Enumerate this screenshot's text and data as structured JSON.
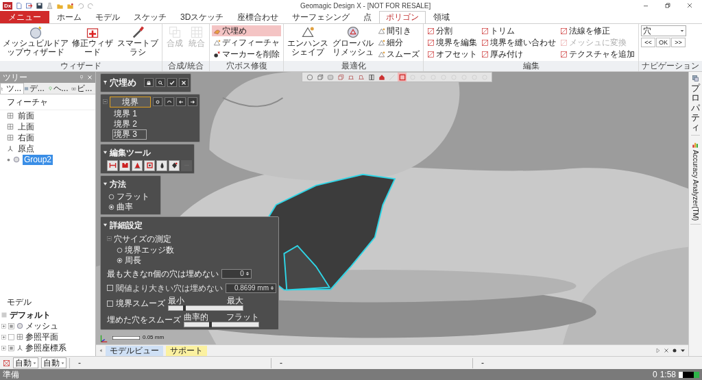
{
  "window": {
    "title": "Geomagic Design X - [NOT FOR RESALE]",
    "app_logo": "Dx"
  },
  "menu_button": "メニュー",
  "tabs": [
    {
      "label": "ホーム",
      "selected": false
    },
    {
      "label": "モデル",
      "selected": false
    },
    {
      "label": "スケッチ",
      "selected": false
    },
    {
      "label": "3Dスケッチ",
      "selected": false
    },
    {
      "label": "座標合わせ",
      "selected": false
    },
    {
      "label": "サーフェシング",
      "selected": false
    },
    {
      "label": "点",
      "selected": false
    },
    {
      "label": "ポリゴン",
      "selected": true
    },
    {
      "label": "領域",
      "selected": false
    }
  ],
  "ribbon": [
    {
      "title": "ウィザード",
      "parts": [
        {
          "kind": "large",
          "label": "メッシュビルドアップウィザード",
          "disabled": false
        },
        {
          "kind": "large",
          "label": "修正ウィザード",
          "disabled": false
        },
        {
          "kind": "large",
          "label": "スマートブラシ",
          "disabled": false
        }
      ]
    },
    {
      "title": "合成/統合",
      "parts": [
        {
          "kind": "large",
          "label": "合成",
          "disabled": true
        },
        {
          "kind": "large",
          "label": "統合",
          "disabled": true
        }
      ]
    },
    {
      "title": "穴ボス修復",
      "parts": [
        {
          "kind": "stack",
          "items": [
            {
              "label": "穴埋め",
              "selected": true,
              "disabled": false
            },
            {
              "label": "ディフィーチャ",
              "selected": false,
              "disabled": false
            },
            {
              "label": "マーカーを削除",
              "selected": false,
              "disabled": false
            }
          ]
        }
      ]
    },
    {
      "title": "最適化",
      "parts": [
        {
          "kind": "large",
          "label": "エンハンスシェイプ",
          "disabled": false
        },
        {
          "kind": "large",
          "label": "グローバルリメッシュ",
          "disabled": false
        },
        {
          "kind": "stack",
          "items": [
            {
              "label": "間引き",
              "selected": false,
              "disabled": false
            },
            {
              "label": "細分",
              "selected": false,
              "disabled": false
            },
            {
              "label": "スムーズ",
              "selected": false,
              "disabled": false
            }
          ]
        }
      ]
    },
    {
      "title": "編集",
      "parts": [
        {
          "kind": "stack",
          "items": [
            {
              "label": "分割",
              "selected": false,
              "disabled": false
            },
            {
              "label": "境界を編集",
              "selected": false,
              "disabled": false
            },
            {
              "label": "オフセット",
              "selected": false,
              "disabled": false
            }
          ]
        },
        {
          "kind": "stack",
          "items": [
            {
              "label": "トリム",
              "selected": false,
              "disabled": false
            },
            {
              "label": "境界を縫い合わせ",
              "selected": false,
              "disabled": false
            },
            {
              "label": "厚み付け",
              "selected": false,
              "disabled": false
            }
          ]
        },
        {
          "kind": "stack",
          "items": [
            {
              "label": "法線を修正",
              "selected": false,
              "disabled": false
            },
            {
              "label": "メッシュに変換",
              "selected": false,
              "disabled": true
            },
            {
              "label": "テクスチャを追加",
              "selected": false,
              "disabled": false
            }
          ]
        }
      ]
    },
    {
      "title": "ナビゲーション",
      "parts": [
        {
          "kind": "nav",
          "dropdown": "穴",
          "buttons": [
            "<<",
            "OK",
            ">>"
          ]
        }
      ]
    }
  ],
  "tree": {
    "title": "ツリー",
    "tabs": [
      {
        "label": "ツ...",
        "selected": true
      },
      {
        "label": "デ...",
        "selected": false
      },
      {
        "label": "ヘ...",
        "selected": false
      },
      {
        "label": "ビ...",
        "selected": false
      }
    ],
    "features_header": "フィーチャ",
    "features": [
      {
        "label": "前面",
        "selected": false
      },
      {
        "label": "上面",
        "selected": false
      },
      {
        "label": "右面",
        "selected": false
      },
      {
        "label": "原点",
        "selected": false
      },
      {
        "label": "Group2",
        "selected": true
      }
    ],
    "model_header": "モデル",
    "default_item": "デフォルト",
    "model_items": [
      {
        "label": "メッシュ",
        "expanded": false,
        "checked": true
      },
      {
        "label": "参照平面",
        "expanded": false,
        "checked": false
      },
      {
        "label": "参照座標系",
        "expanded": false,
        "checked": true
      }
    ]
  },
  "viewport": {
    "scale_label": "0.05 mm",
    "toolbar": [
      {
        "selected": false,
        "disabled": false
      },
      {
        "selected": false,
        "disabled": false
      },
      {
        "selected": false,
        "disabled": false
      },
      {
        "selected": false,
        "disabled": false
      },
      {
        "selected": false,
        "disabled": false
      },
      {
        "selected": false,
        "disabled": false
      },
      {
        "selected": false,
        "disabled": false
      },
      {
        "selected": false,
        "disabled": false
      },
      {
        "selected": false,
        "disabled": true
      },
      {
        "selected": true,
        "disabled": false
      },
      {
        "selected": false,
        "disabled": true
      },
      {
        "selected": false,
        "disabled": true
      },
      {
        "selected": false,
        "disabled": true
      },
      {
        "selected": false,
        "disabled": true
      },
      {
        "selected": false,
        "disabled": true
      },
      {
        "selected": false,
        "disabled": true
      },
      {
        "selected": false,
        "disabled": true
      },
      {
        "selected": false,
        "disabled": true
      }
    ]
  },
  "fill_dialog": {
    "title": "穴埋め",
    "boundary": {
      "button": "境界",
      "expanded": true,
      "items": [
        {
          "label": "境界 1",
          "selected": false
        },
        {
          "label": "境界 2",
          "selected": false
        },
        {
          "label": "境界 3",
          "selected": true
        }
      ]
    },
    "edit_tools": {
      "title": "編集ツール",
      "expanded": true,
      "tools": [
        {
          "disabled": false
        },
        {
          "disabled": false
        },
        {
          "disabled": false
        },
        {
          "disabled": false
        },
        {
          "disabled": false
        },
        {
          "disabled": false
        },
        {
          "disabled": true
        }
      ]
    },
    "method": {
      "title": "方法",
      "expanded": true,
      "options": [
        {
          "label": "フラット",
          "selected": false
        },
        {
          "label": "曲率",
          "selected": true
        }
      ]
    },
    "details": {
      "title": "詳細設定",
      "expanded": true,
      "size_section": {
        "title": "穴サイズの測定",
        "expanded": true,
        "options": [
          {
            "label": "境界エッジ数",
            "selected": false
          },
          {
            "label": "周長",
            "selected": true
          }
        ]
      },
      "rows": [
        {
          "kind": "spinner",
          "label": "最も大きなn個の穴は埋めない",
          "value": "0"
        },
        {
          "kind": "check_field",
          "label": "閾値より大きい穴は埋めない",
          "checked": false,
          "value": "0.8699 mm"
        },
        {
          "kind": "check_slider",
          "label": "境界スムーズ",
          "checked": false,
          "min_label": "最小",
          "max_label": "最大",
          "level": 0.2
        },
        {
          "kind": "slider",
          "label": "埋めた穴をスムーズ",
          "min_label": "曲率的",
          "max_label": "フラット",
          "level": 0.35
        }
      ]
    }
  },
  "right_dock": [
    {
      "kind": "cjk",
      "label": "プロパティ"
    },
    {
      "kind": "latin",
      "label": "Accuracy Analyzer(TM)"
    }
  ],
  "view_tabs": [
    {
      "label": "モデルビュー",
      "color": "#cfe0f5"
    },
    {
      "label": "サポート",
      "color": "#fbf1a0"
    }
  ],
  "status_row": {
    "dropdowns": [
      "自動",
      "自動"
    ],
    "fields": [
      "-",
      "-",
      "-"
    ]
  },
  "status_bar": {
    "text": "準備",
    "counter": "0",
    "time": "1:58"
  }
}
